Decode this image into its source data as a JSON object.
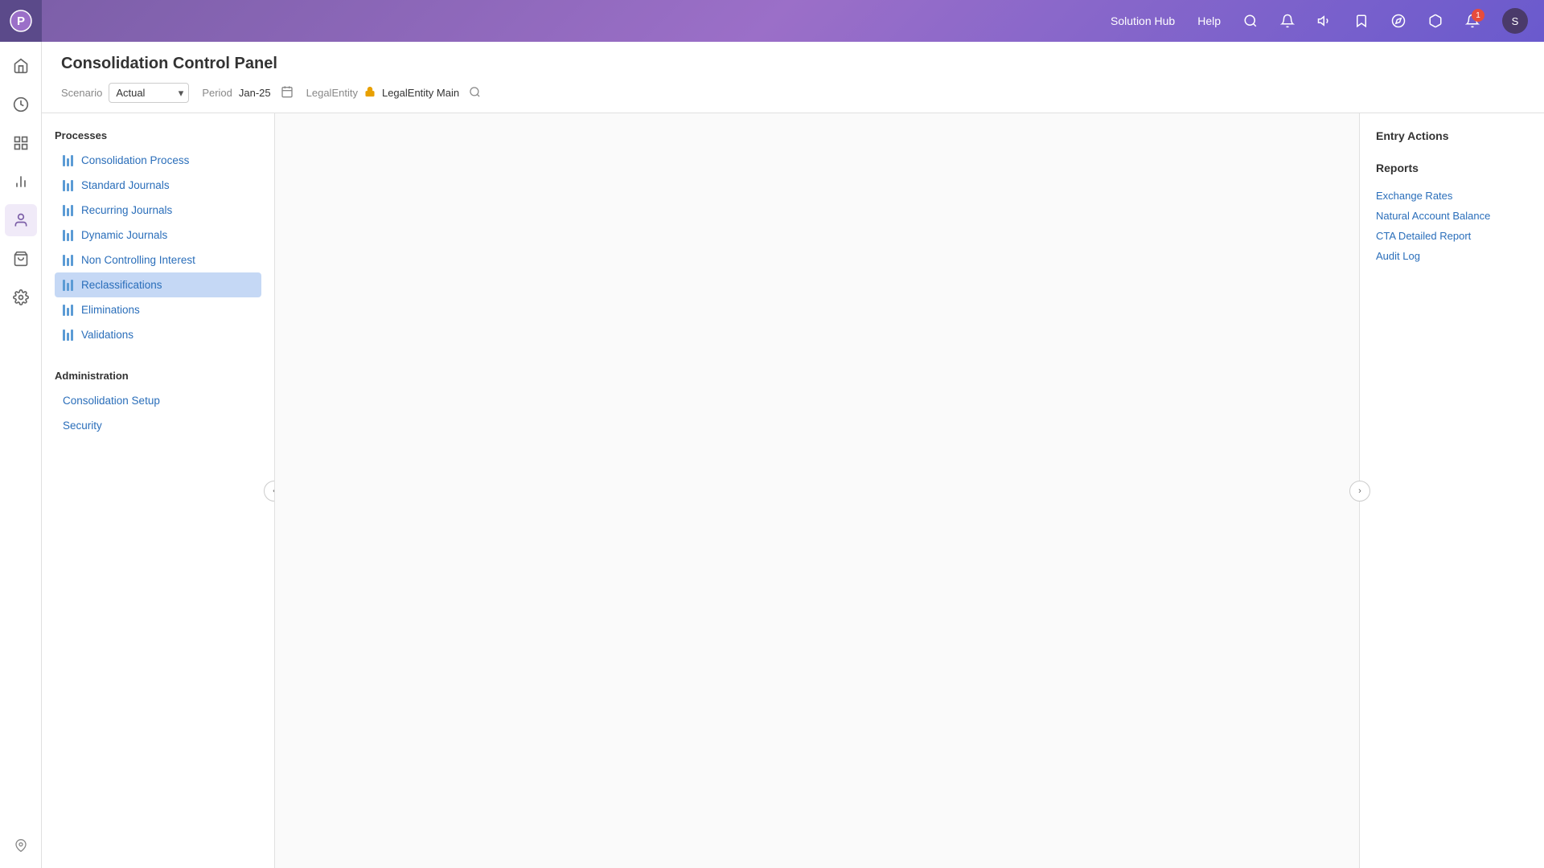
{
  "header": {
    "logo_initial": "P",
    "nav_items": [
      "Solution Hub",
      "Help"
    ],
    "icons": [
      "search",
      "megaphone",
      "bookmark",
      "settings",
      "box",
      "bell",
      "avatar"
    ],
    "bell_badge": "1",
    "avatar_label": "S"
  },
  "page": {
    "title": "Consolidation Control Panel"
  },
  "filter_bar": {
    "scenario_label": "Scenario",
    "scenario_value": "Actual",
    "period_label": "Period",
    "period_value": "Jan-25",
    "legal_entity_label": "LegalEntity",
    "legal_entity_value": "LegalEntity Main"
  },
  "left_panel": {
    "processes_title": "Processes",
    "processes_items": [
      {
        "label": "Consolidation Process",
        "id": "consolidation-process"
      },
      {
        "label": "Standard Journals",
        "id": "standard-journals"
      },
      {
        "label": "Recurring Journals",
        "id": "recurring-journals"
      },
      {
        "label": "Dynamic Journals",
        "id": "dynamic-journals"
      },
      {
        "label": "Non Controlling Interest",
        "id": "non-controlling-interest"
      },
      {
        "label": "Reclassifications",
        "id": "reclassifications",
        "active": true
      },
      {
        "label": "Eliminations",
        "id": "eliminations"
      },
      {
        "label": "Validations",
        "id": "validations"
      }
    ],
    "administration_title": "Administration",
    "administration_items": [
      {
        "label": "Consolidation Setup",
        "id": "consolidation-setup"
      },
      {
        "label": "Security",
        "id": "security"
      }
    ]
  },
  "right_panel": {
    "entry_actions_title": "Entry Actions",
    "reports_title": "Reports",
    "report_links": [
      "Exchange Rates",
      "Natural Account Balance",
      "CTA Detailed Report",
      "Audit Log"
    ]
  },
  "icon_bar": {
    "items": [
      {
        "icon": "home",
        "label": "Home",
        "unicode": "⌂"
      },
      {
        "icon": "clock",
        "label": "Recent",
        "unicode": "◷"
      },
      {
        "icon": "grid",
        "label": "Apps",
        "unicode": "⊞"
      },
      {
        "icon": "chart",
        "label": "Reports",
        "unicode": "📊"
      },
      {
        "icon": "person",
        "label": "Profile",
        "unicode": "👤",
        "active": true
      },
      {
        "icon": "bag",
        "label": "Packages",
        "unicode": "🛍"
      },
      {
        "icon": "gear",
        "label": "Settings",
        "unicode": "⚙"
      }
    ],
    "pin_icon": "📌"
  }
}
